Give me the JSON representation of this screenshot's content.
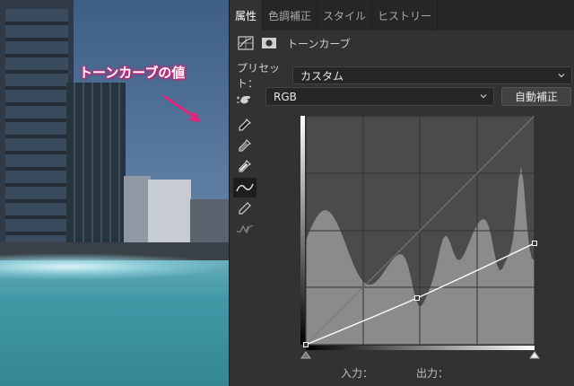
{
  "annotation": {
    "text": "トーンカーブの値",
    "color": "#e0247d"
  },
  "tabs": [
    {
      "label": "属性",
      "active": true
    },
    {
      "label": "色調補正",
      "active": false
    },
    {
      "label": "スタイル",
      "active": false
    },
    {
      "label": "ヒストリー",
      "active": false
    }
  ],
  "header": {
    "title": "トーンカーブ",
    "icons": [
      "adjustment-layer-icon",
      "mask-icon"
    ]
  },
  "preset": {
    "label": "プリセット：",
    "value": "カスタム"
  },
  "channel": {
    "value": "RGB"
  },
  "auto_button": {
    "label": "自動補正"
  },
  "tools": [
    "target-adjust-hand-icon",
    "black-point-eyedropper-icon",
    "gray-point-eyedropper-icon",
    "white-point-eyedropper-icon",
    "curve-point-tool-icon",
    "pencil-draw-icon",
    "smooth-curve-icon"
  ],
  "active_tool": "curve-point-tool-icon",
  "curve": {
    "points": [
      [
        0,
        0
      ],
      [
        124,
        52
      ],
      [
        255,
        113
      ]
    ],
    "colors": {
      "curve": "#ffffff",
      "histogram": "#8a8a8a",
      "grid_bg": "#4a4a4a"
    }
  },
  "io": {
    "input_label": "入力：",
    "output_label": "出力："
  }
}
